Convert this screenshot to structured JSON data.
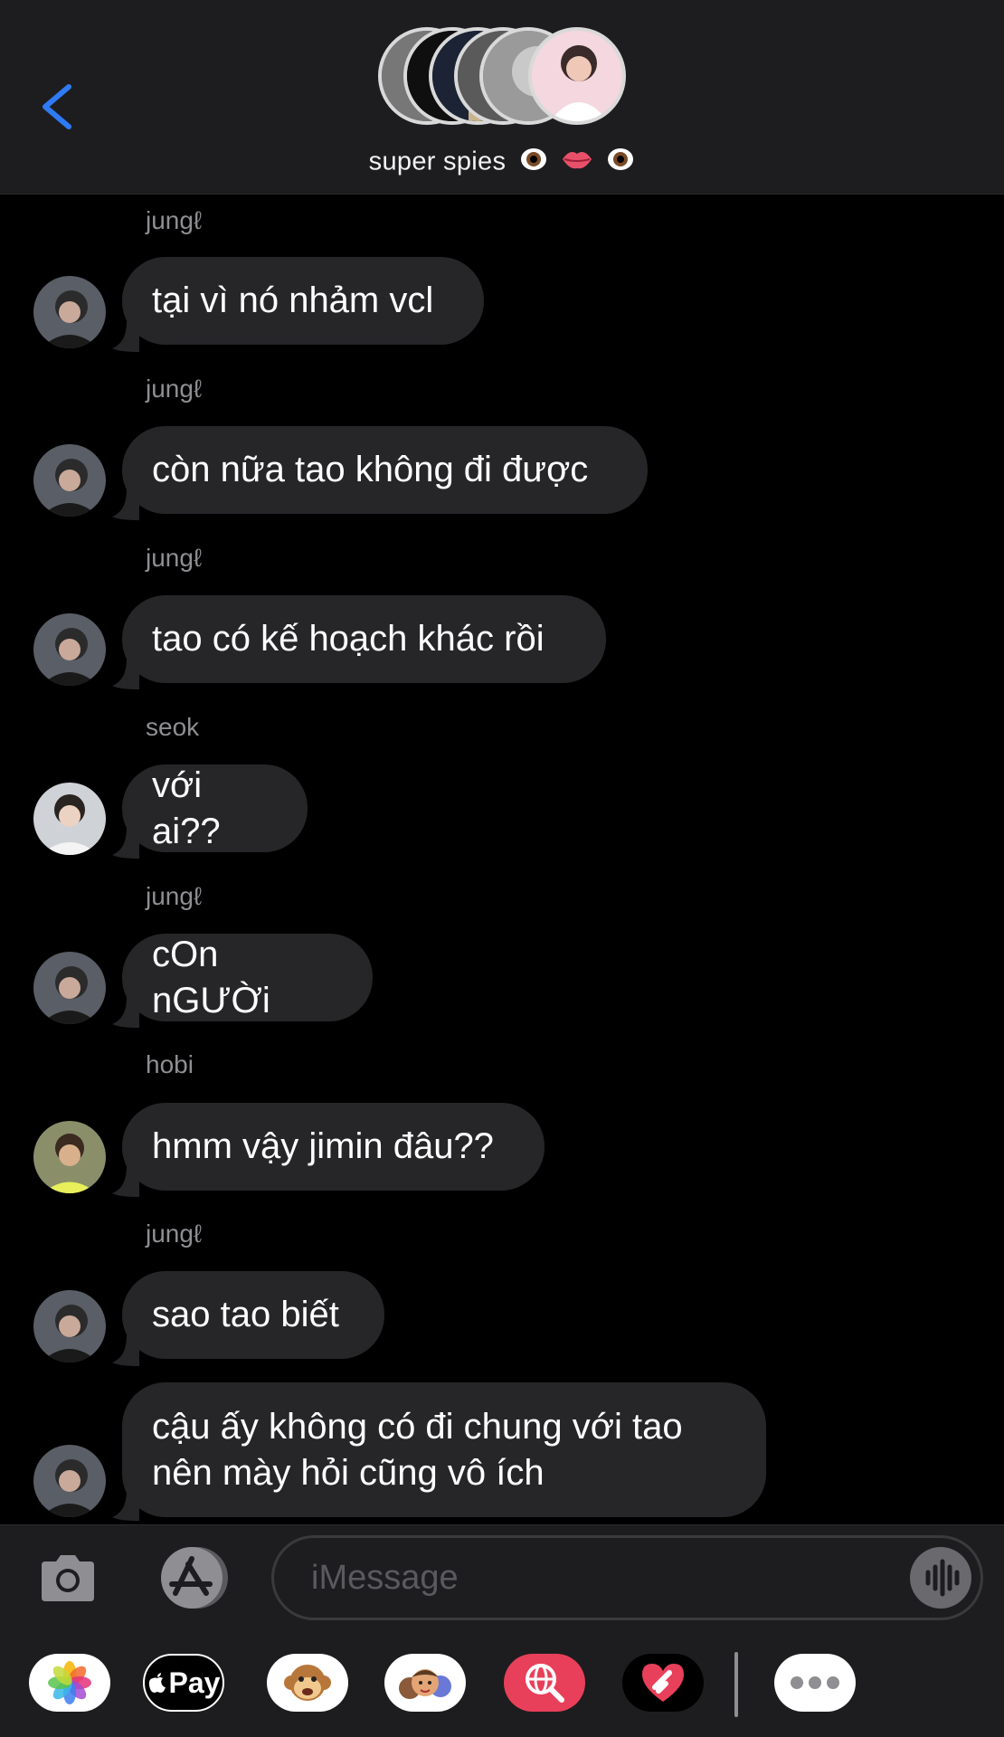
{
  "header": {
    "back_label": "back",
    "group_name": "super spies",
    "group_emojis": [
      "eyes-emoji",
      "lips-emoji",
      "eye-emoji"
    ]
  },
  "messages": [
    {
      "sender": "jungℓ",
      "text": "tại vì nó nhảm vcl"
    },
    {
      "sender": "jungℓ",
      "text": "còn nữa tao không đi được"
    },
    {
      "sender": "jungℓ",
      "text": "tao có kế hoạch khác rồi"
    },
    {
      "sender": "seok",
      "text": "với ai??"
    },
    {
      "sender": "jungℓ",
      "text": "cOn nGƯỜi"
    },
    {
      "sender": "hobi",
      "text": "hmm vậy jimin đâu??"
    },
    {
      "sender": "jungℓ",
      "text": "sao tao biết"
    },
    {
      "sender": "",
      "text": "cậu ấy không có đi chung với tao\nnên mày hỏi cũng vô ích"
    }
  ],
  "input": {
    "placeholder": "iMessage"
  },
  "tray": {
    "applepay_label": "Pay"
  },
  "colors": {
    "accent": "#2f7bf5",
    "bubble": "#262629",
    "background": "#000000",
    "bar": "#1d1d1f"
  }
}
